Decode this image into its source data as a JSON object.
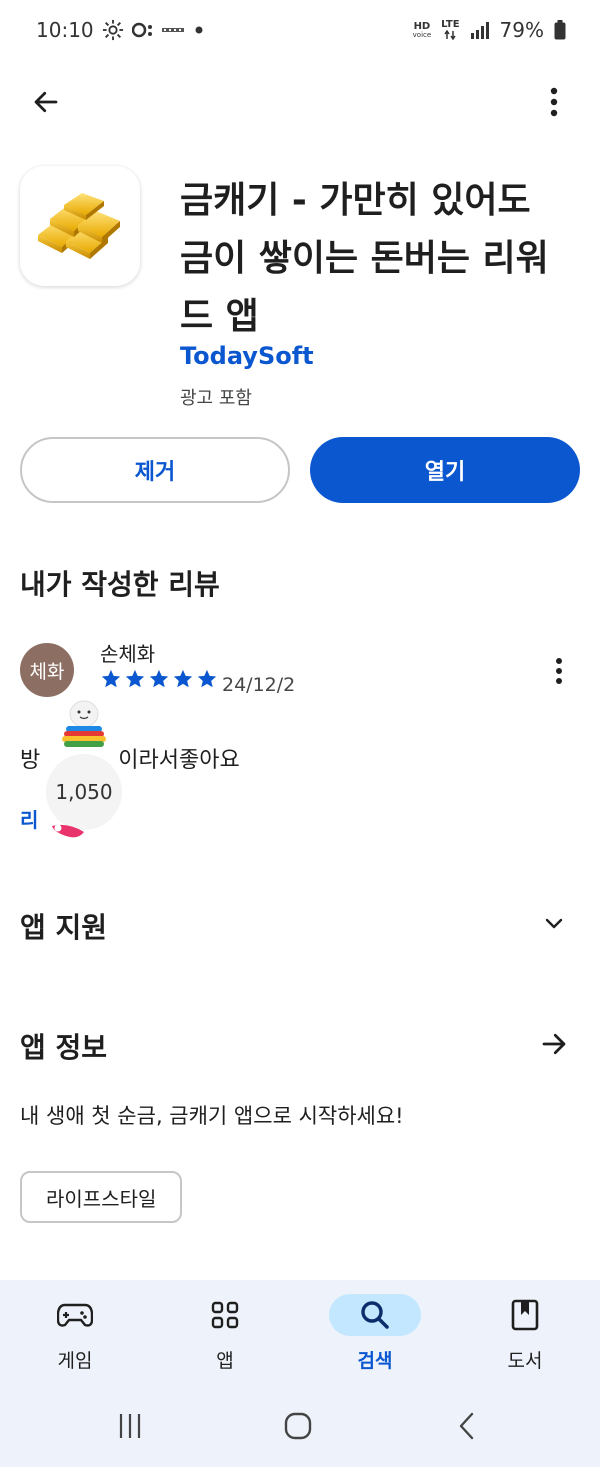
{
  "status_bar": {
    "time": "10:10",
    "battery": "79%",
    "hd_voice_top": "HD",
    "hd_voice_bottom": "voice",
    "network": "LTE"
  },
  "app": {
    "title": "금캐기 - 가만히 있어도 금이 쌓이는 돈버는 리워드 앱",
    "developer": "TodaySoft",
    "ads": "광고 포함",
    "icon": "gold-bars-icon"
  },
  "actions": {
    "remove_label": "제거",
    "open_label": "열기"
  },
  "review": {
    "section_title": "내가 작성한 리뷰",
    "avatar_text": "체화",
    "reviewer": "손체화",
    "rating": 5,
    "date": "24/12/2",
    "text_prefix": "방",
    "text_suffix": "이라서좋아요",
    "link_text": "리"
  },
  "overlay": {
    "points": "1,050"
  },
  "support": {
    "title": "앱 지원"
  },
  "info": {
    "title": "앱 정보",
    "description": "내 생애 첫 순금, 금캐기 앱으로 시작하세요!",
    "category_chip": "라이프스타일"
  },
  "bottom_nav": {
    "items": [
      {
        "label": "게임",
        "icon": "gamepad-icon"
      },
      {
        "label": "앱",
        "icon": "apps-grid-icon"
      },
      {
        "label": "검색",
        "icon": "search-icon"
      },
      {
        "label": "도서",
        "icon": "book-icon"
      }
    ],
    "active_index": 2
  },
  "colors": {
    "accent": "#0b57d0",
    "nav_bg": "#eef3fb",
    "active_pill": "#c2e7ff"
  }
}
